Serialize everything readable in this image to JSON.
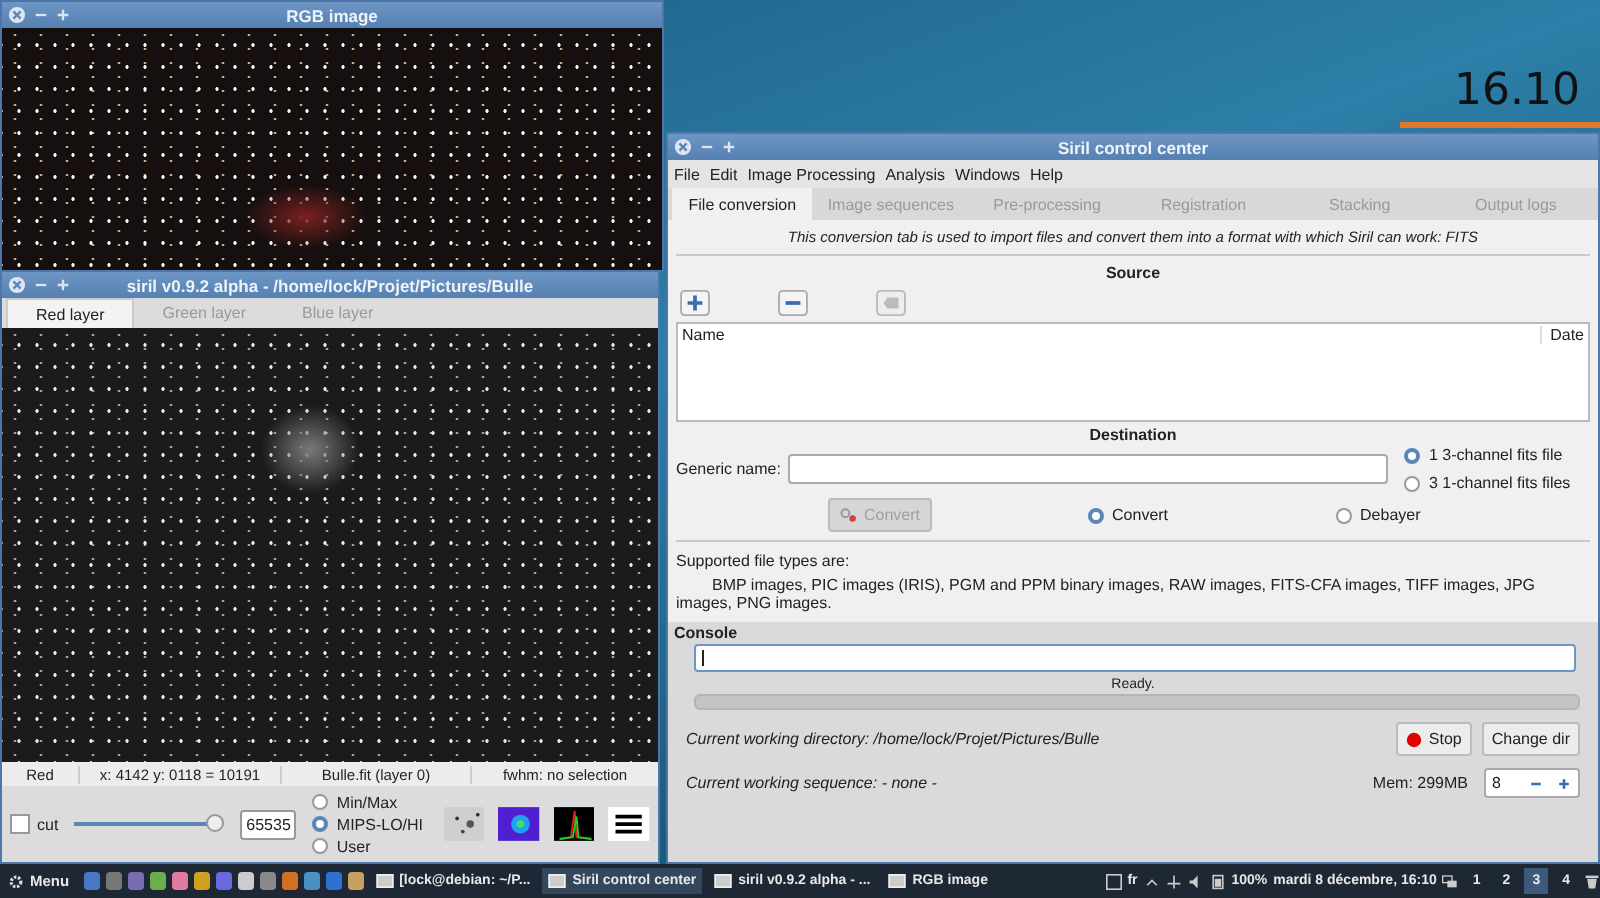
{
  "desktop": {
    "clock": "16.10"
  },
  "rgb_window": {
    "title": "RGB image"
  },
  "siril_window": {
    "title": "siril v0.9.2 alpha - /home/lock/Projet/Pictures/Bulle",
    "tabs": [
      {
        "label": "Red layer",
        "selected": true
      },
      {
        "label": "Green layer",
        "selected": false
      },
      {
        "label": "Blue layer",
        "selected": false
      }
    ],
    "status": [
      "Red",
      "x: 4142 y: 0118 = 10191",
      "Bulle.fit (layer 0)",
      "fwhm: no selection"
    ],
    "cut": {
      "label": "cut",
      "checked": false
    },
    "slider": {
      "level": 0.95,
      "value": "65535"
    },
    "scale_modes": [
      {
        "label": "Min/Max",
        "selected": false
      },
      {
        "label": "MIPS-LO/HI",
        "selected": true
      },
      {
        "label": "User",
        "selected": false
      }
    ]
  },
  "control_center": {
    "title": "Siril control center",
    "menu": [
      "File",
      "Edit",
      "Image Processing",
      "Analysis",
      "Windows",
      "Help"
    ],
    "tabs": [
      {
        "label": "File conversion",
        "selected": true
      },
      {
        "label": "Image sequences",
        "selected": false
      },
      {
        "label": "Pre-processing",
        "selected": false
      },
      {
        "label": "Registration",
        "selected": false
      },
      {
        "label": "Stacking",
        "selected": false
      },
      {
        "label": "Output logs",
        "selected": false
      }
    ],
    "intro": "This conversion tab is used to import files and convert them into a format with which Siril can work: FITS",
    "source": {
      "heading": "Source",
      "columns": [
        "Name",
        "Date"
      ]
    },
    "destination": {
      "heading": "Destination",
      "generic_name_label": "Generic name:",
      "output_options": [
        {
          "label": "1 3-channel fits file",
          "selected": true
        },
        {
          "label": "3 1-channel fits files",
          "selected": false
        }
      ],
      "convert_button": {
        "label": "Convert",
        "disabled": true
      },
      "modes": [
        {
          "label": "Convert",
          "selected": true
        },
        {
          "label": "Debayer",
          "selected": false
        }
      ]
    },
    "supported_heading": "Supported file types are:",
    "supported_list": "BMP images, PIC images (IRIS), PGM and PPM binary images, RAW images, FITS-CFA images, TIFF images, JPG images, PNG images.",
    "console": {
      "heading": "Console",
      "status": "Ready.",
      "progress": {
        "level": 0
      }
    },
    "cwd": "Current working directory: /home/lock/Projet/Pictures/Bulle",
    "cws": "Current working sequence: - none -",
    "stop_button": "Stop",
    "change_dir_button": "Change dir",
    "mem": "Mem: 299MB",
    "threads": "8"
  },
  "taskbar": {
    "menu": "Menu",
    "tasks": [
      {
        "label": "[lock@debian: ~/P...",
        "selected": false
      },
      {
        "label": "Siril control center",
        "selected": true
      },
      {
        "label": "siril v0.9.2 alpha - ...",
        "selected": false
      },
      {
        "label": "RGB image",
        "selected": false
      }
    ],
    "language": "fr",
    "battery": "100%",
    "clock": "mardi 8 décembre, 16:10",
    "workspaces": [
      {
        "label": "1",
        "selected": false
      },
      {
        "label": "2",
        "selected": false
      },
      {
        "label": "3",
        "selected": true
      },
      {
        "label": "4",
        "selected": false
      }
    ]
  }
}
